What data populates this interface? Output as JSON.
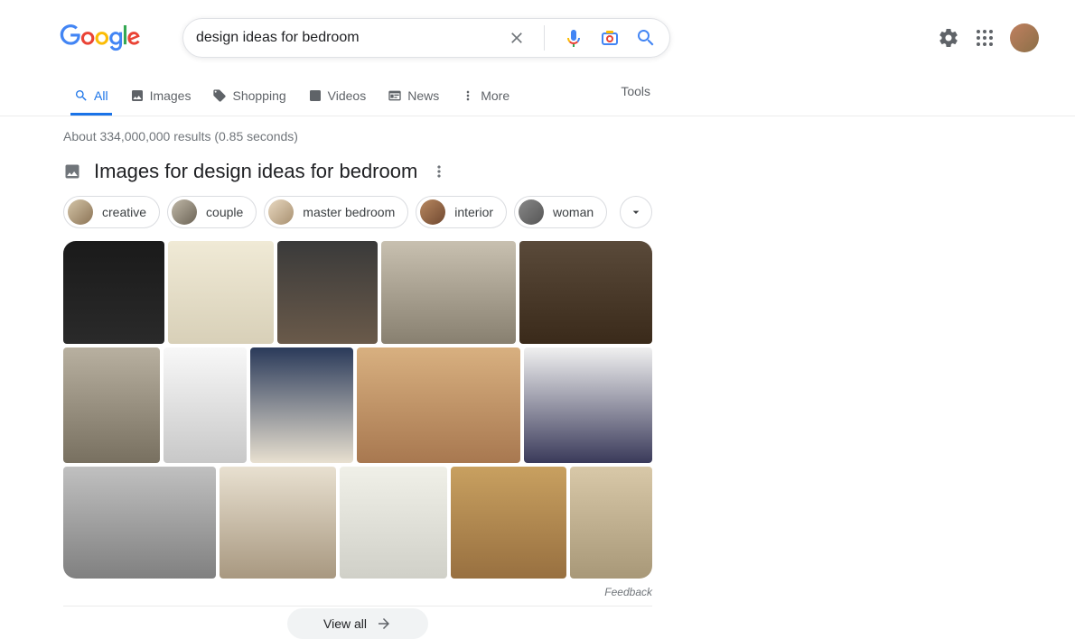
{
  "search": {
    "query": "design ideas for bedroom"
  },
  "tabs": {
    "all": "All",
    "images": "Images",
    "shopping": "Shopping",
    "videos": "Videos",
    "news": "News",
    "more": "More",
    "tools": "Tools"
  },
  "results_stats": "About 334,000,000 results (0.85 seconds)",
  "images_section": {
    "title": "Images for design ideas for bedroom",
    "chips": {
      "creative": "creative",
      "couple": "couple",
      "master_bedroom": "master bedroom",
      "interior": "interior",
      "woman": "woman"
    },
    "feedback": "Feedback",
    "view_all": "View all"
  }
}
